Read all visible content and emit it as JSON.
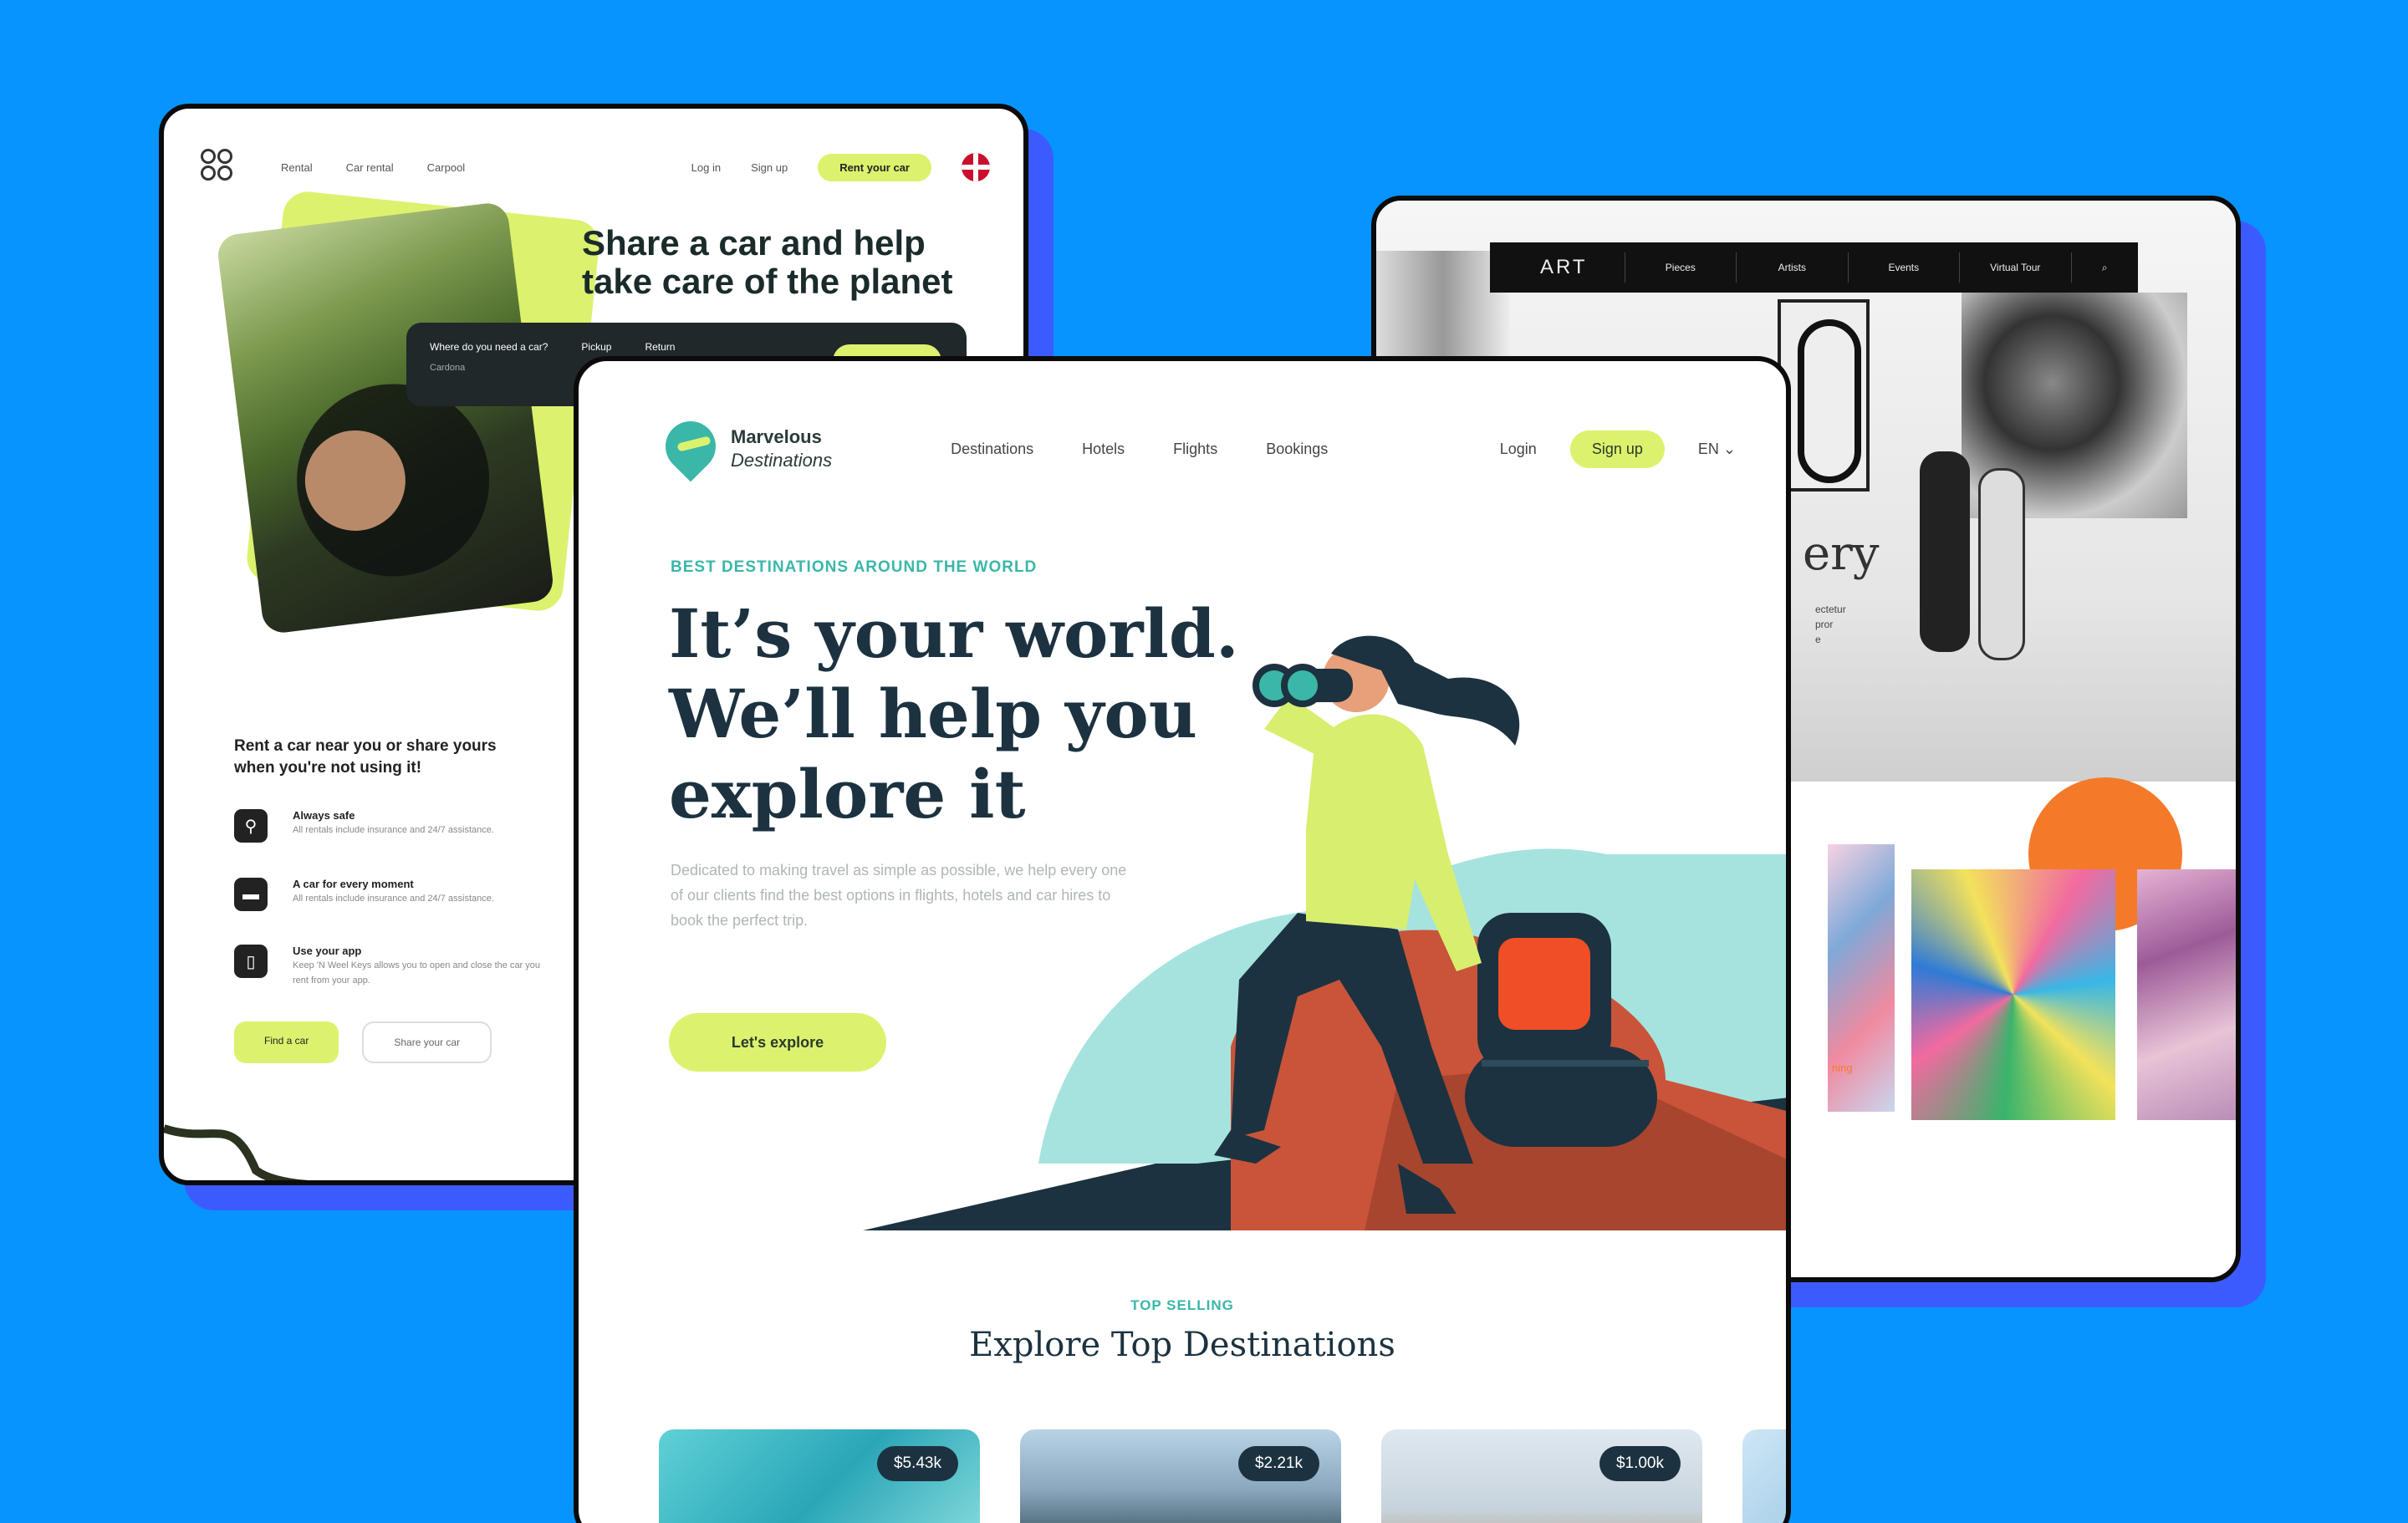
{
  "colors": {
    "background": "#0794FF",
    "accent_lime": "#dcf26e",
    "teal": "#3ab7a8",
    "navy": "#1c3240",
    "orange": "#f47a2a"
  },
  "car_site": {
    "nav": {
      "links": [
        "Rental",
        "Car rental",
        "Carpool"
      ],
      "login": "Log in",
      "signup": "Sign up",
      "cta": "Rent your car"
    },
    "headline": "Share a car and help take care of the planet",
    "form": {
      "where_label": "Where do you need a car?",
      "where_value": "Cardona",
      "pickup": "Pickup",
      "return": "Return"
    },
    "subhead": "Rent a car near you or share yours when you're not using it!",
    "features": [
      {
        "icon": "shield-icon",
        "title": "Always safe",
        "text": "All rentals include insurance and 24/7 assistance."
      },
      {
        "icon": "car-icon",
        "title": "A car for every moment",
        "text": "All rentals include insurance and 24/7 assistance."
      },
      {
        "icon": "phone-icon",
        "title": "Use your app",
        "text": "Keep 'N Weel Keys allows you to open and close the car you rent from your app."
      }
    ],
    "buttons": {
      "find": "Find a car",
      "share": "Share your car"
    }
  },
  "art_site": {
    "nav": {
      "brand": "ART",
      "items": [
        "Pieces",
        "Artists",
        "Events",
        "Virtual Tour"
      ]
    },
    "hero_partial": "ery",
    "desc_partial": [
      "ectetur",
      "pror",
      "e"
    ],
    "painting_caption": "ning"
  },
  "travel_site": {
    "logo": {
      "line1": "Marvelous",
      "line2": "Destinations"
    },
    "nav": {
      "links": [
        "Destinations",
        "Hotels",
        "Flights",
        "Bookings"
      ],
      "login": "Login",
      "signup": "Sign up",
      "lang": "EN"
    },
    "eyebrow": "BEST DESTINATIONS AROUND THE WORLD",
    "headline": "It’s your world. We’ll help you explore it",
    "description": "Dedicated to making travel as simple as possible, we help every one of our clients find the best options in flights, hotels and car hires to book the perfect trip.",
    "cta": "Let's explore",
    "section_eyebrow": "TOP SELLING",
    "section_title": "Explore Top Destinations",
    "destinations": [
      {
        "price": "$5.43k"
      },
      {
        "price": "$2.21k"
      },
      {
        "price": "$1.00k"
      }
    ]
  }
}
